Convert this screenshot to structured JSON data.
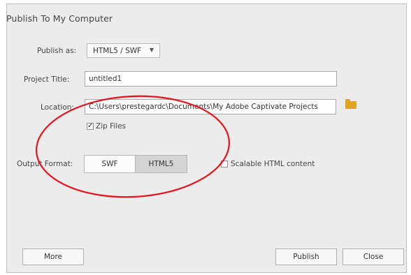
{
  "dialog": {
    "title": "Publish To My Computer"
  },
  "form": {
    "publish_as": {
      "label": "Publish as:",
      "selected": "HTML5 / SWF"
    },
    "project_title": {
      "label": "Project Title:",
      "value": "untitled1"
    },
    "location": {
      "label": "Location:",
      "value": "C:\\Users\\prestegardc\\Documents\\My Adobe Captivate Projects"
    },
    "zip_files": {
      "label": "Zip Files",
      "checked": true
    },
    "output_format": {
      "label": "Output Format:",
      "options": [
        "SWF",
        "HTML5"
      ],
      "selected": "HTML5"
    },
    "scalable": {
      "label": "Scalable HTML content",
      "checked": false
    }
  },
  "buttons": {
    "more": "More",
    "publish": "Publish",
    "close": "Close"
  },
  "colors": {
    "annotation": "#e8121b",
    "folder": "#e0a41e",
    "selected_segment": "#d4d4d4"
  },
  "icons": {
    "dropdown": "chevron-down-icon",
    "folder": "folder-icon",
    "check": "checkmark-icon"
  }
}
